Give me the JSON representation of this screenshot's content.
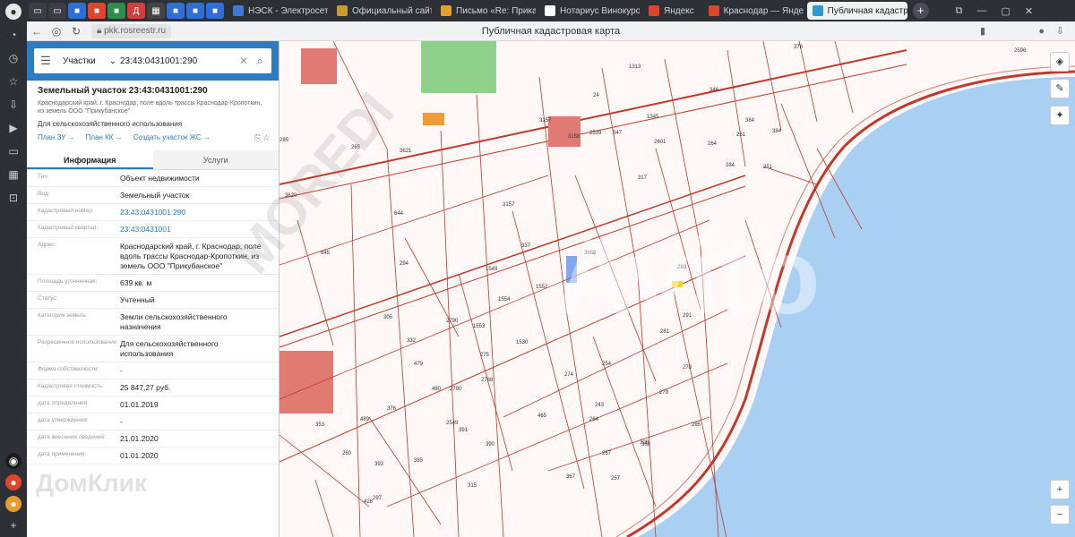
{
  "browser": {
    "tabs": [
      {
        "label": "НЭСК - Электросети",
        "color": "#3d7ad6"
      },
      {
        "label": "Официальный сайт",
        "color": "#c99a2e"
      },
      {
        "label": "Письмо «Re: Приказ»",
        "color": "#e0a32a"
      },
      {
        "label": "Нотариус Винокуров",
        "color": "#3b3b3b"
      },
      {
        "label": "Яндекс",
        "color": "#e0442b"
      },
      {
        "label": "Краснодар — Яндекс",
        "color": "#e0442b"
      },
      {
        "label": "Публичная кадастр",
        "color": "#2d9bd2"
      }
    ],
    "url": "pkk.rosreestr.ru",
    "page_title": "Публичная кадастровая карта"
  },
  "search": {
    "type_label": "Участки",
    "query": "23:43:0431001:290"
  },
  "parcel": {
    "title": "Земельный участок 23:43:0431001:290",
    "address_short": "Краснодарский край, г. Краснодар, поле вдоль трассы Краснодар-Кропоткин, из земель ООО \"Прикубанское\"",
    "use": "Для сельскохозяйственного использования",
    "links": [
      "План ЗУ →",
      "План КК →",
      "Создать участок ЖС →"
    ],
    "tab_info": "Информация",
    "tab_services": "Услуги",
    "fields": [
      {
        "key": "Тип:",
        "value": "Объект недвижимости"
      },
      {
        "key": "Вид:",
        "value": "Земельный участок"
      },
      {
        "key": "Кадастровый номер:",
        "value": "23:43:0431001:290"
      },
      {
        "key": "Кадастровый квартал:",
        "value": "23:43:0431001"
      },
      {
        "key": "Адрес:",
        "value": "Краснодарский край, г. Краснодар, поле вдоль трассы Краснодар-Кропоткин, из земель ООО \"Прикубанское\""
      },
      {
        "key": "Площадь уточненная:",
        "value": "639 кв. м"
      },
      {
        "key": "Статус:",
        "value": "Учтенный"
      },
      {
        "key": "Категория земель:",
        "value": "Земли сельскохозяйственного назначения"
      },
      {
        "key": "Разрешенное использование:",
        "value": "Для сельскохозяйственного использования"
      },
      {
        "key": "Форма собственности:",
        "value": "-"
      },
      {
        "key": "Кадастровая стоимость:",
        "value": "25 847,27 руб."
      },
      {
        "key": "дата определения:",
        "value": "01.01.2019"
      },
      {
        "key": "дата утверждения:",
        "value": "-"
      },
      {
        "key": "дата внесения сведений:",
        "value": "21.01.2020"
      },
      {
        "key": "дата применения:",
        "value": "01.01.2020"
      }
    ]
  },
  "map_labels": [
    "1313",
    "346",
    "378",
    "2596",
    "24",
    "1345",
    "3157",
    "3158",
    "2539",
    "347",
    "2601",
    "264",
    "251",
    "384",
    "285",
    "265",
    "3621",
    "317",
    "284",
    "251",
    "644",
    "3157",
    "3668",
    "3620",
    "645",
    "294",
    "1549",
    "337",
    "280",
    "1552",
    "1554",
    "291",
    "281",
    "305",
    "332",
    "2790",
    "1553",
    "1530",
    "275",
    "274",
    "254",
    "479",
    "480",
    "2788",
    "2790",
    "278",
    "465",
    "2549",
    "264",
    "279",
    "376",
    "257",
    "243",
    "353",
    "489",
    "385",
    "391",
    "390",
    "308",
    "260",
    "393",
    "367",
    "315",
    "297",
    "368",
    "257",
    "428",
    "295",
    "384"
  ],
  "watermarks": {
    "avito": "Avito",
    "moredi": "MOREDI",
    "domclick": "ДомКлик"
  }
}
